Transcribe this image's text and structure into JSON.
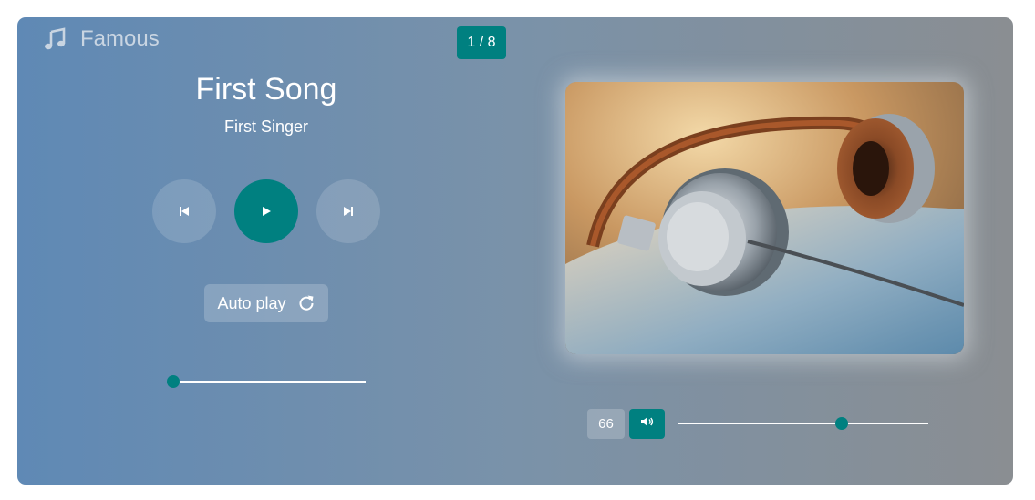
{
  "brand": {
    "icon": "music-note-icon",
    "name": "Famous"
  },
  "counter": {
    "text": "1 / 8"
  },
  "song": {
    "title": "First Song",
    "artist": "First Singer"
  },
  "controls": {
    "prev_icon": "skip-previous-icon",
    "play_icon": "play-icon",
    "next_icon": "skip-next-icon"
  },
  "autoplay": {
    "label": "Auto play",
    "icon": "repeat-icon"
  },
  "progress": {
    "value": 0
  },
  "album": {
    "image": "headphones-photo"
  },
  "volume": {
    "value": 66,
    "display": "66",
    "icon": "volume-icon"
  },
  "colors": {
    "accent": "#008080",
    "gradient_start": "#5f89b5",
    "gradient_end": "#8a8e92",
    "text": "#ffffff"
  }
}
